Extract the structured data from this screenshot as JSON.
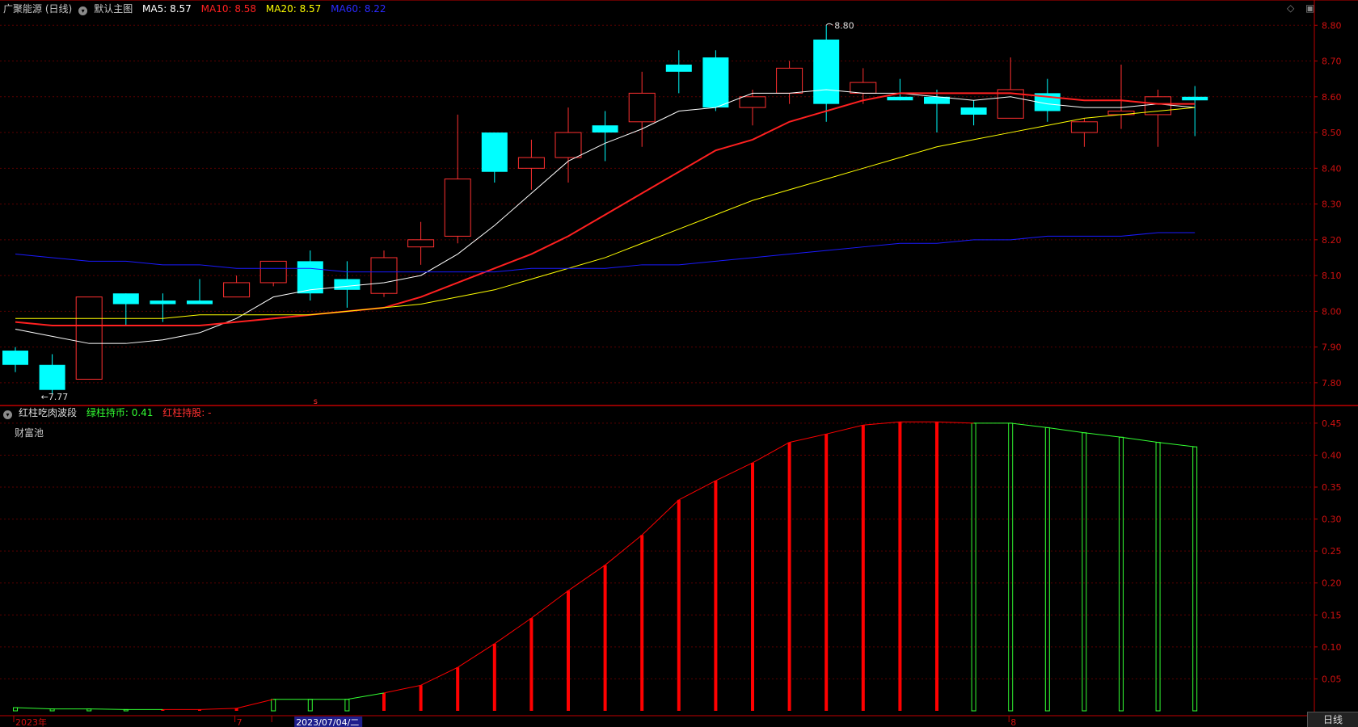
{
  "header": {
    "title": "广聚能源 (日线)",
    "main_chart_name": "默认主图",
    "ma5": {
      "label": "MA5: 8.57",
      "color": "#ffffff"
    },
    "ma10": {
      "label": "MA10: 8.58",
      "color": "#ff2020"
    },
    "ma20": {
      "label": "MA20: 8.57",
      "color": "#ffff00"
    },
    "ma60": {
      "label": "MA60: 8.22",
      "color": "#1a1aff"
    }
  },
  "indicator_header": {
    "name": "红柱吃肉波段",
    "green_label": "绿柱持币: 0.41",
    "red_label": "红柱持股: -",
    "sub_label": "财富池"
  },
  "colors": {
    "up": "#ff3030",
    "down": "#00ffff",
    "axis": "#c00000",
    "grid": "#5a0000",
    "bar_red": "#ff0000",
    "bar_green": "#33ff33"
  },
  "icons": {
    "collapse": "chevron-down-icon",
    "diamond": "diamond-icon",
    "window": "window-icon"
  },
  "daily_button": "日线",
  "chart_data": [
    {
      "type": "candlestick",
      "title": "广聚能源 (日线)",
      "y_ticks": [
        "8.80",
        "8.70",
        "8.60",
        "8.50",
        "8.40",
        "8.30",
        "8.20",
        "8.10",
        "8.00",
        "7.90",
        "7.80"
      ],
      "ylim": [
        7.75,
        8.83
      ],
      "annotations": {
        "high_label": "8.80",
        "low_label": "←7.77"
      },
      "marker": "s",
      "candles": [
        {
          "o": 7.89,
          "h": 7.9,
          "l": 7.83,
          "c": 7.85
        },
        {
          "o": 7.85,
          "h": 7.88,
          "l": 7.77,
          "c": 7.78
        },
        {
          "o": 7.81,
          "h": 8.04,
          "l": 7.81,
          "c": 8.04
        },
        {
          "o": 8.05,
          "h": 8.05,
          "l": 7.96,
          "c": 8.02
        },
        {
          "o": 8.03,
          "h": 8.05,
          "l": 7.97,
          "c": 8.02
        },
        {
          "o": 8.03,
          "h": 8.09,
          "l": 8.02,
          "c": 8.02
        },
        {
          "o": 8.04,
          "h": 8.1,
          "l": 8.04,
          "c": 8.08
        },
        {
          "o": 8.08,
          "h": 8.14,
          "l": 8.07,
          "c": 8.14
        },
        {
          "o": 8.14,
          "h": 8.17,
          "l": 8.03,
          "c": 8.05
        },
        {
          "o": 8.09,
          "h": 8.14,
          "l": 8.01,
          "c": 8.06
        },
        {
          "o": 8.05,
          "h": 8.17,
          "l": 8.04,
          "c": 8.15
        },
        {
          "o": 8.18,
          "h": 8.25,
          "l": 8.13,
          "c": 8.2
        },
        {
          "o": 8.21,
          "h": 8.55,
          "l": 8.19,
          "c": 8.37
        },
        {
          "o": 8.5,
          "h": 8.5,
          "l": 8.36,
          "c": 8.39
        },
        {
          "o": 8.4,
          "h": 8.48,
          "l": 8.34,
          "c": 8.43
        },
        {
          "o": 8.43,
          "h": 8.57,
          "l": 8.36,
          "c": 8.5
        },
        {
          "o": 8.52,
          "h": 8.56,
          "l": 8.42,
          "c": 8.5
        },
        {
          "o": 8.53,
          "h": 8.67,
          "l": 8.46,
          "c": 8.61
        },
        {
          "o": 8.69,
          "h": 8.73,
          "l": 8.61,
          "c": 8.67
        },
        {
          "o": 8.71,
          "h": 8.73,
          "l": 8.56,
          "c": 8.57
        },
        {
          "o": 8.57,
          "h": 8.62,
          "l": 8.52,
          "c": 8.6
        },
        {
          "o": 8.61,
          "h": 8.7,
          "l": 8.58,
          "c": 8.68
        },
        {
          "o": 8.76,
          "h": 8.8,
          "l": 8.53,
          "c": 8.58
        },
        {
          "o": 8.61,
          "h": 8.68,
          "l": 8.58,
          "c": 8.64
        },
        {
          "o": 8.6,
          "h": 8.65,
          "l": 8.59,
          "c": 8.59
        },
        {
          "o": 8.6,
          "h": 8.62,
          "l": 8.5,
          "c": 8.58
        },
        {
          "o": 8.57,
          "h": 8.59,
          "l": 8.52,
          "c": 8.55
        },
        {
          "o": 8.54,
          "h": 8.71,
          "l": 8.54,
          "c": 8.62
        },
        {
          "o": 8.61,
          "h": 8.65,
          "l": 8.53,
          "c": 8.56
        },
        {
          "o": 8.5,
          "h": 8.54,
          "l": 8.46,
          "c": 8.53
        },
        {
          "o": 8.55,
          "h": 8.69,
          "l": 8.51,
          "c": 8.56
        },
        {
          "o": 8.55,
          "h": 8.62,
          "l": 8.46,
          "c": 8.6
        },
        {
          "o": 8.6,
          "h": 8.63,
          "l": 8.49,
          "c": 8.59
        }
      ],
      "series": [
        {
          "name": "MA5",
          "values": [
            7.95,
            7.93,
            7.91,
            7.91,
            7.92,
            7.94,
            7.98,
            8.04,
            8.06,
            8.07,
            8.08,
            8.1,
            8.16,
            8.24,
            8.33,
            8.42,
            8.47,
            8.51,
            8.56,
            8.57,
            8.61,
            8.61,
            8.62,
            8.61,
            8.61,
            8.6,
            8.59,
            8.6,
            8.58,
            8.57,
            8.57,
            8.58,
            8.57
          ]
        },
        {
          "name": "MA10",
          "values": [
            7.97,
            7.96,
            7.96,
            7.96,
            7.96,
            7.96,
            7.97,
            7.98,
            7.99,
            8.0,
            8.01,
            8.04,
            8.08,
            8.12,
            8.16,
            8.21,
            8.27,
            8.33,
            8.39,
            8.45,
            8.48,
            8.53,
            8.56,
            8.59,
            8.61,
            8.61,
            8.61,
            8.61,
            8.6,
            8.59,
            8.59,
            8.58,
            8.58
          ]
        },
        {
          "name": "MA20",
          "values": [
            7.98,
            7.98,
            7.98,
            7.98,
            7.98,
            7.99,
            7.99,
            7.99,
            7.99,
            8.0,
            8.01,
            8.02,
            8.04,
            8.06,
            8.09,
            8.12,
            8.15,
            8.19,
            8.23,
            8.27,
            8.31,
            8.34,
            8.37,
            8.4,
            8.43,
            8.46,
            8.48,
            8.5,
            8.52,
            8.54,
            8.55,
            8.56,
            8.57
          ]
        },
        {
          "name": "MA60",
          "values": [
            8.16,
            8.15,
            8.14,
            8.14,
            8.13,
            8.13,
            8.12,
            8.12,
            8.12,
            8.11,
            8.11,
            8.11,
            8.11,
            8.11,
            8.12,
            8.12,
            8.12,
            8.13,
            8.13,
            8.14,
            8.15,
            8.16,
            8.17,
            8.18,
            8.19,
            8.19,
            8.2,
            8.2,
            8.21,
            8.21,
            8.21,
            8.22,
            8.22
          ]
        }
      ]
    },
    {
      "type": "bar",
      "title": "红柱吃肉波段",
      "y_ticks": [
        "0.45",
        "0.40",
        "0.35",
        "0.30",
        "0.25",
        "0.20",
        "0.15",
        "0.10",
        "0.05"
      ],
      "ylim": [
        0,
        0.465
      ],
      "x_labels": [
        {
          "index": 0,
          "text": "2023年"
        },
        {
          "index": 6,
          "text": "7"
        },
        {
          "index": 7,
          "text": "2023/07/04/二",
          "highlight": true
        },
        {
          "index": 27,
          "text": "8"
        }
      ],
      "values": [
        0.005,
        0.003,
        0.003,
        0.002,
        0.002,
        0.002,
        0.004,
        0.018,
        0.018,
        0.018,
        0.028,
        0.04,
        0.068,
        0.105,
        0.145,
        0.188,
        0.228,
        0.275,
        0.33,
        0.36,
        0.388,
        0.42,
        0.433,
        0.447,
        0.452,
        0.452,
        0.45,
        0.45,
        0.443,
        0.435,
        0.428,
        0.42,
        0.413
      ],
      "colors": [
        "g",
        "g",
        "g",
        "g",
        "r",
        "r",
        "r",
        "g",
        "g",
        "g",
        "r",
        "r",
        "r",
        "r",
        "r",
        "r",
        "r",
        "r",
        "r",
        "r",
        "r",
        "r",
        "r",
        "r",
        "r",
        "r",
        "g",
        "g",
        "g",
        "g",
        "g",
        "g",
        "g"
      ]
    }
  ]
}
